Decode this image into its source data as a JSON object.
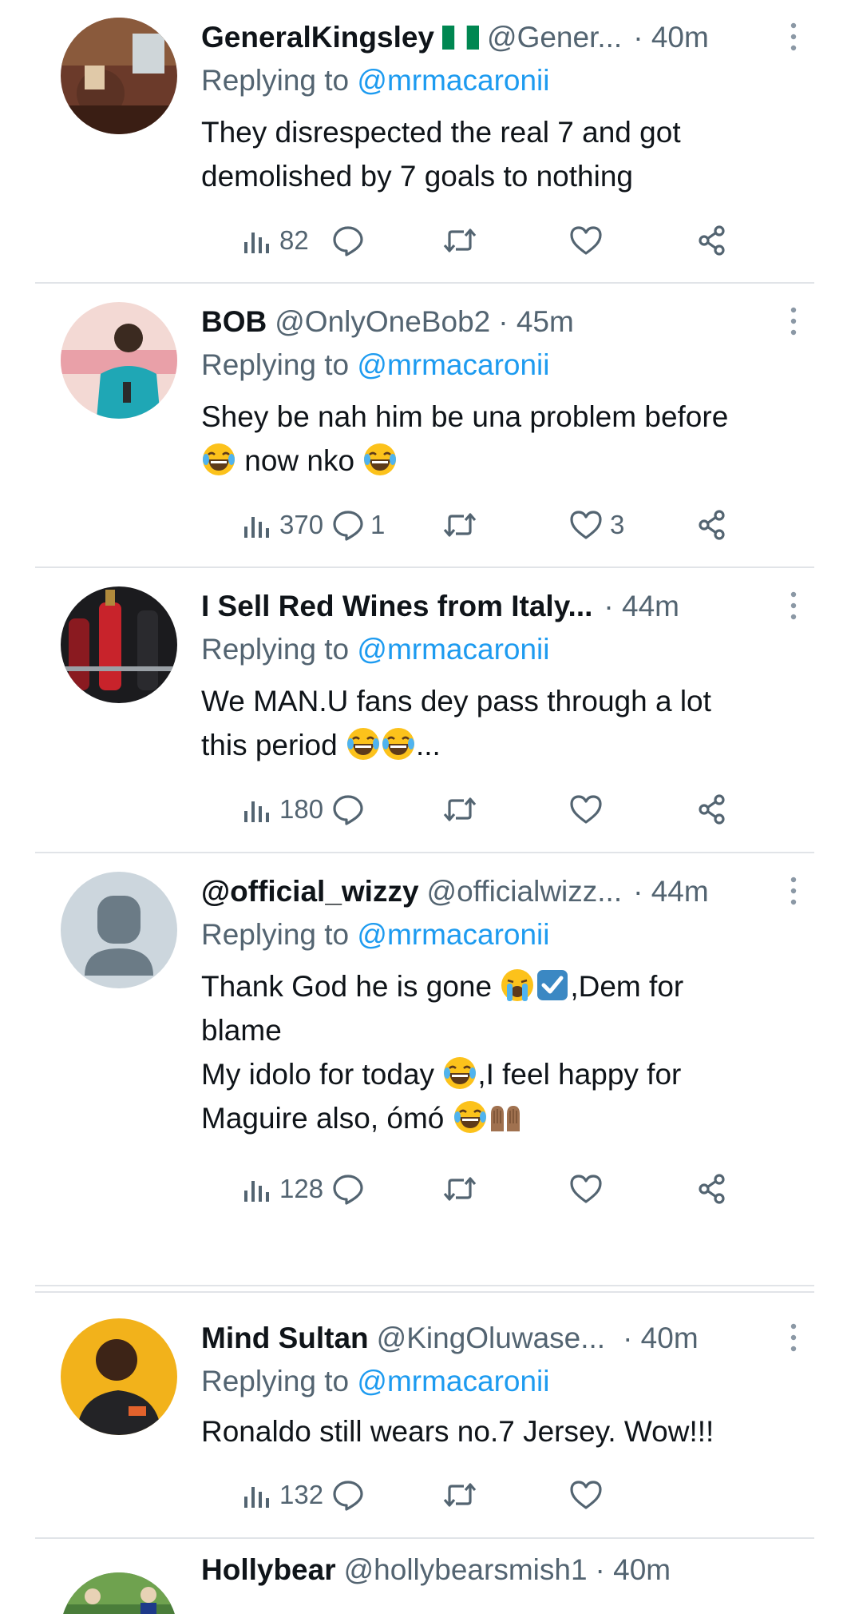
{
  "colors": {
    "accent": "#1d9bf0",
    "secondary_text": "#536471",
    "primary_text": "#0f1419",
    "divider": "#e1e4e8"
  },
  "icons": {
    "views": "bar-chart-icon",
    "reply": "speech-bubble-icon",
    "retweet": "retweet-arrows-icon",
    "like": "heart-icon",
    "share": "share-nodes-icon",
    "more": "vertical-ellipsis-icon"
  },
  "tweets": [
    {
      "name": "GeneralKingsley",
      "handle": "@Gener...",
      "time": "· 40m",
      "replying_prefix": "Replying to ",
      "replying_to": "@mrmacaronii",
      "lines": [
        "They disrespected the real 7 and got",
        "demolished by 7 goals to nothing"
      ],
      "views": "82",
      "replies": "",
      "likes": ""
    },
    {
      "name": "BOB",
      "handle": "@OnlyOneBob2",
      "time": "· 45m",
      "replying_prefix": "Replying to ",
      "replying_to": "@mrmacaronii",
      "lines": [
        "Shey be nah him be una problem before",
        "now nko"
      ],
      "views": "370",
      "replies": "1",
      "likes": "3"
    },
    {
      "name": "I Sell Red Wines from Italy...",
      "handle": "",
      "time": "· 44m",
      "replying_prefix": "Replying to ",
      "replying_to": "@mrmacaronii",
      "lines": [
        "We MAN.U fans dey pass through a lot",
        "this period",
        "..."
      ],
      "views": "180",
      "replies": "",
      "likes": ""
    },
    {
      "name": "@official_wizzy",
      "handle": "@officialwizz...",
      "time": "· 44m",
      "replying_prefix": "Replying to ",
      "replying_to": "@mrmacaronii",
      "lines": [
        "Thank God he is gone",
        ",Dem for",
        "blame",
        "My idolo for today",
        ",I feel happy for",
        "Maguire also, ómó"
      ],
      "views": "128",
      "replies": "",
      "likes": ""
    },
    {
      "name": "Mind Sultan",
      "handle": "@KingOluwase...",
      "time": "· 40m",
      "replying_prefix": "Replying to ",
      "replying_to": "@mrmacaronii",
      "lines": [
        "Ronaldo still wears no.7 Jersey. Wow!!!"
      ],
      "views": "132",
      "replies": "",
      "likes": ""
    },
    {
      "name": "Hollybear",
      "handle": "@hollybearsmish1",
      "time": "· 40m"
    }
  ]
}
